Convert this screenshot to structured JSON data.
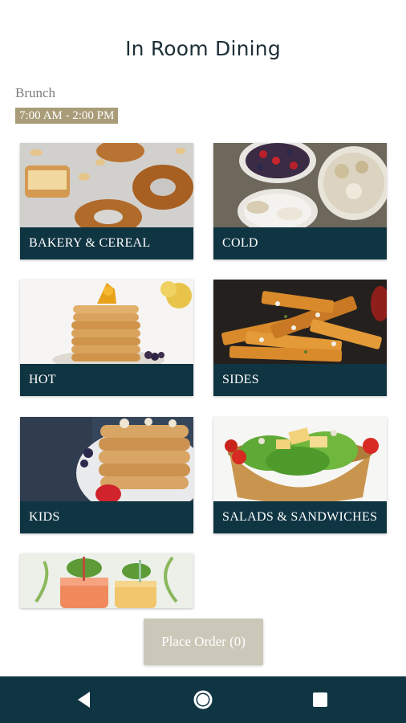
{
  "header": {
    "title": "In Room Dining"
  },
  "menu": {
    "meal_label": "Brunch",
    "hours": "7:00 AM - 2:00 PM"
  },
  "categories": [
    {
      "label": "BAKERY & CEREAL",
      "image": "bakery-photo"
    },
    {
      "label": "COLD",
      "image": "cold-bowls-photo"
    },
    {
      "label": "HOT",
      "image": "pancakes-photo"
    },
    {
      "label": "SIDES",
      "image": "fries-photo"
    },
    {
      "label": "KIDS",
      "image": "kids-pancakes-photo"
    },
    {
      "label": "SALADS & SANDWICHES",
      "image": "salad-photo"
    },
    {
      "label": "",
      "image": "drinks-photo"
    }
  ],
  "order": {
    "label": "Place Order (0)"
  },
  "navigation": {
    "back_icon": "back-triangle-icon",
    "home_icon": "home-circle-icon",
    "recents_icon": "recents-square-icon"
  },
  "colors": {
    "caption_bar": "#0f3442",
    "badge": "#a99c79",
    "order_button": "#ccc8b9",
    "nav_bar": "#0f3442"
  }
}
